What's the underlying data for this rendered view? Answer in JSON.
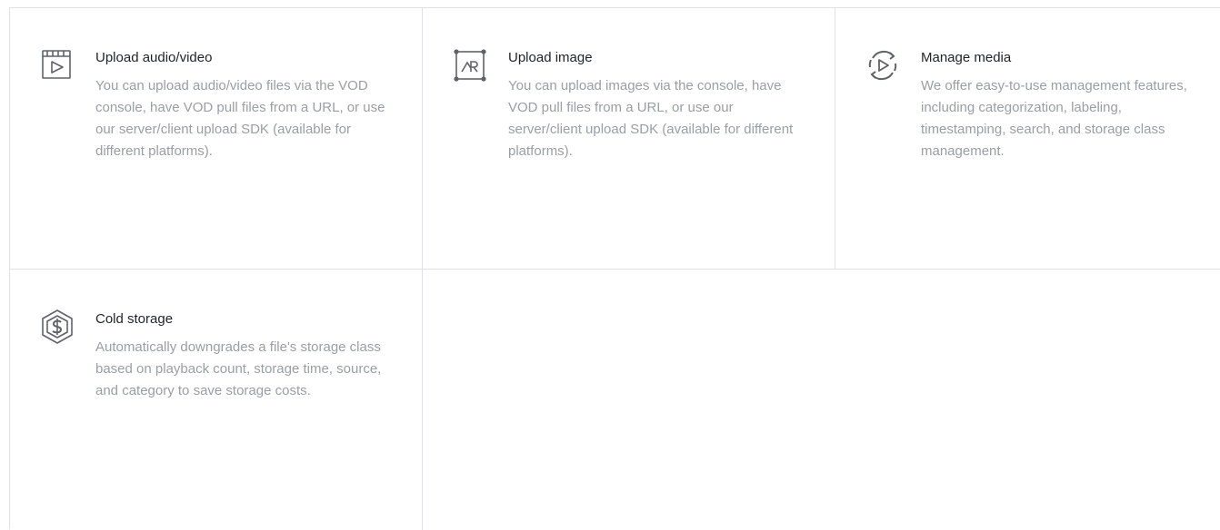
{
  "features": [
    {
      "icon": "video-icon",
      "title": "Upload audio/video",
      "description": "You can upload audio/video files via the VOD console, have VOD pull files from a URL, or use our server/client upload SDK (available for different platforms)."
    },
    {
      "icon": "image-icon",
      "title": "Upload image",
      "description": "You can upload images via the console, have VOD pull files from a URL, or use our server/client upload SDK (available for different platforms)."
    },
    {
      "icon": "manage-media-icon",
      "title": "Manage media",
      "description": "We offer easy-to-use management features, including categorization, labeling, timestamping, search, and storage class management."
    },
    {
      "icon": "cold-storage-icon",
      "title": "Cold storage",
      "description": "Automatically downgrades a file's storage class based on playback count, storage time, source, and category to save storage costs."
    }
  ],
  "colors": {
    "title": "#1f2329",
    "description": "#9a9ea5",
    "icon": "#5f6368",
    "border": "#dfe1e6"
  }
}
